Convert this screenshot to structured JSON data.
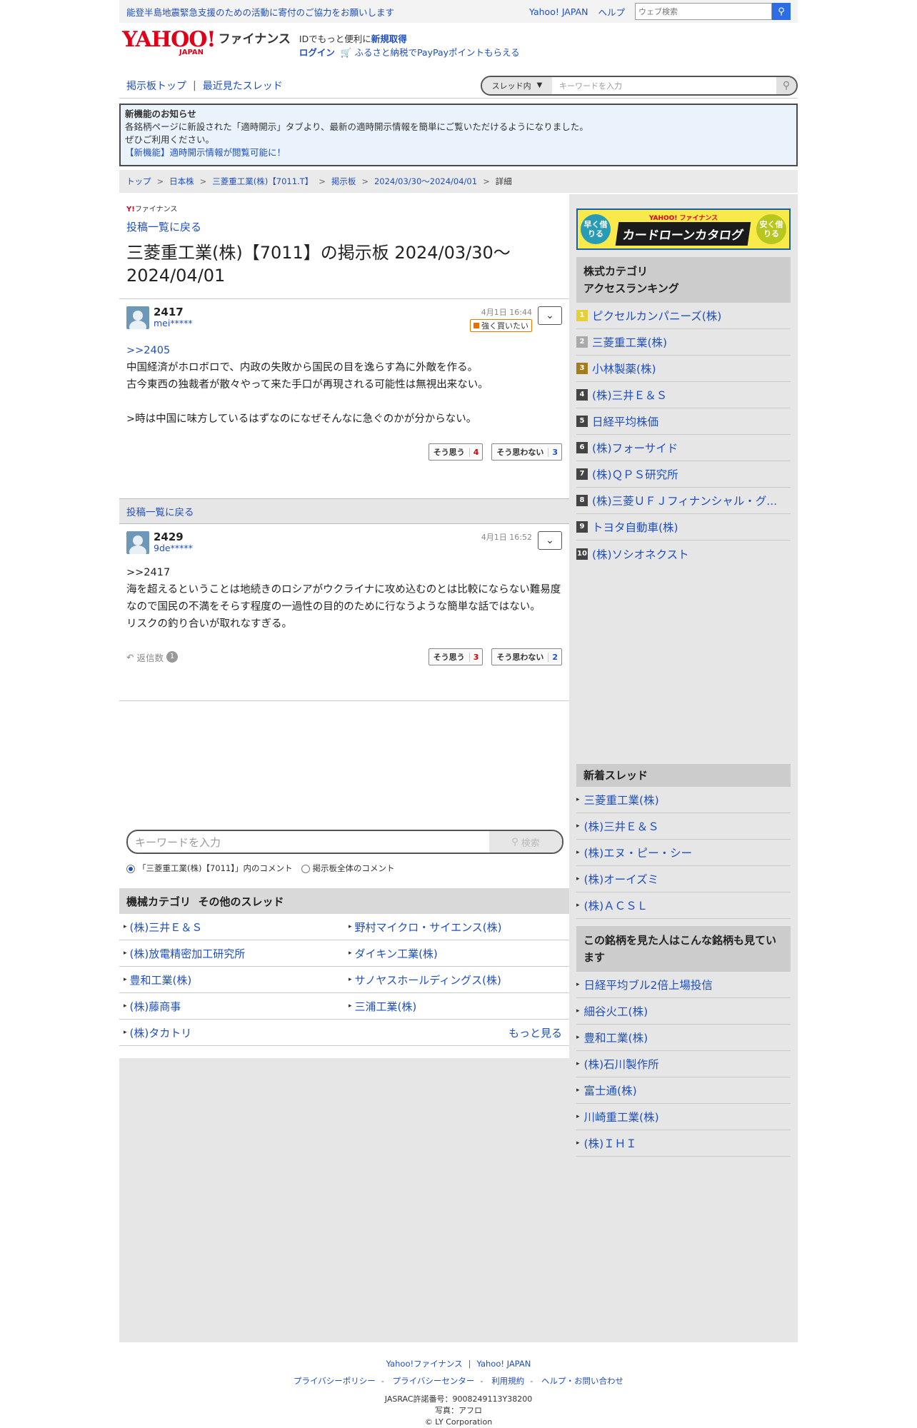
{
  "topbar": {
    "notice": "能登半島地震緊急支援のための活動に寄付のご協力をお願いします",
    "yahoo_japan": "Yahoo! JAPAN",
    "help": "ヘルプ",
    "search_placeholder": "ウェブ検索"
  },
  "header": {
    "logo_yahoo": "YAHOO!",
    "logo_japan": "JAPAN",
    "logo_finance": "ファイナンス",
    "id_text": "IDでもっと便利に",
    "signup": "新規取得",
    "login": "ログイン",
    "furusato": "ふるさと納税でPayPayポイントもらえる"
  },
  "nav": {
    "board_top": "掲示板トップ",
    "recent_threads": "最近見たスレッド",
    "scope": "スレッド内",
    "keyword_placeholder": "キーワードを入力"
  },
  "newfeature": {
    "title": "新機能のお知らせ",
    "line1": "各銘柄ページに新設された「適時開示」タブより、最新の適時開示情報を簡単にご覧いただけるようになりました。",
    "line2": "ぜひご利用ください。",
    "link": "【新機能】適時開示情報が閲覧可能に！"
  },
  "breadcrumb": [
    "トップ",
    "日本株",
    "三菱重工業(株)【7011.T】",
    "掲示板",
    "2024/03/30〜2024/04/01",
    "詳細"
  ],
  "main": {
    "logo_y": "Y!",
    "logo_text": "ファイナンス",
    "back_link": "投稿一覧に戻る",
    "page_title": "三菱重工業(株)【7011】の掲示板 2024/03/30〜2024/04/01",
    "posts": [
      {
        "number": "2417",
        "user": "mei*****",
        "time": "4月1日 16:44",
        "badge": "強く買いたい",
        "reply_to": ">>2405",
        "body": "中国経済がホロボロで、内政の失敗から国民の目を逸らす為に外敵を作る。\n古今東西の独裁者が散々やって来た手口が再現される可能性は無視出来ない。\n\n>時は中国に味方しているはずなのになぜそんなに急ぐのかが分からない。",
        "agree_label": "そう思う",
        "agree": "4",
        "disagree_label": "そう思わない",
        "disagree": "3"
      },
      {
        "number": "2429",
        "user": "9de*****",
        "time": "4月1日 16:52",
        "reply_to": ">>2417",
        "body": "海を超えるということは地続きのロシアがウクライナに攻め込むのとは比較にならない難易度なので国民の不満をそらす程度の一過性の目的のために行なうような簡単な話ではない。\nリスクの釣り合いが取れなすぎる。",
        "reply_label": "返信数",
        "reply_count": "1",
        "agree_label": "そう思う",
        "agree": "3",
        "disagree_label": "そう思わない",
        "disagree": "2"
      }
    ],
    "search_placeholder": "キーワードを入力",
    "search_button": "検索",
    "radio_thread": "「三菱重工業(株)【7011】」内のコメント",
    "radio_all": "掲示板全体のコメント",
    "other_threads_title": "機械カテゴリ  その他のスレッド",
    "other_threads": [
      "(株)三井Ｅ＆Ｓ",
      "野村マイクロ・サイエンス(株)",
      "(株)放電精密加工研究所",
      "ダイキン工業(株)",
      "豊和工業(株)",
      "サノヤスホールディングス(株)",
      "(株)藤商事",
      "三浦工業(株)",
      "(株)タカトリ"
    ],
    "more": "もっと見る"
  },
  "side": {
    "ad": {
      "left": "早く借りる",
      "brand": "YAHOO! ファイナンス",
      "center": "カードローンカタログ",
      "right": "安く借りる"
    },
    "ranking_title_1": "株式カテゴリ",
    "ranking_title_2": "アクセスランキング",
    "ranking": [
      "ピクセルカンパニーズ(株)",
      "三菱重工業(株)",
      "小林製薬(株)",
      "(株)三井Ｅ＆Ｓ",
      "日経平均株価",
      "(株)フォーサイド",
      "(株)ＱＰＳ研究所",
      "(株)三菱ＵＦＪフィナンシャル・グ...",
      "トヨタ自動車(株)",
      "(株)ソシオネクスト"
    ],
    "new_threads_title": "新着スレッド",
    "new_threads": [
      "三菱重工業(株)",
      "(株)三井Ｅ＆Ｓ",
      "(株)エヌ・ピー・シー",
      "(株)オーイズミ",
      "(株)ＡＣＳＬ"
    ],
    "also_viewed_title": "この銘柄を見た人はこんな銘柄も見ています",
    "also_viewed": [
      "日経平均ブル2倍上場投信",
      "細谷火工(株)",
      "豊和工業(株)",
      "(株)石川製作所",
      "富士通(株)",
      "川崎重工業(株)",
      "(株)ＩＨＩ"
    ]
  },
  "footer": {
    "links1": [
      "Yahoo!ファイナンス",
      "Yahoo! JAPAN"
    ],
    "links2": [
      "プライバシーポリシー",
      "プライバシーセンター",
      "利用規約",
      "ヘルプ・お問い合わせ"
    ],
    "jasrac": "JASRAC許諾番号：9008249113Y38200",
    "photo": "写真：アフロ",
    "copyright": "© LY Corporation"
  }
}
